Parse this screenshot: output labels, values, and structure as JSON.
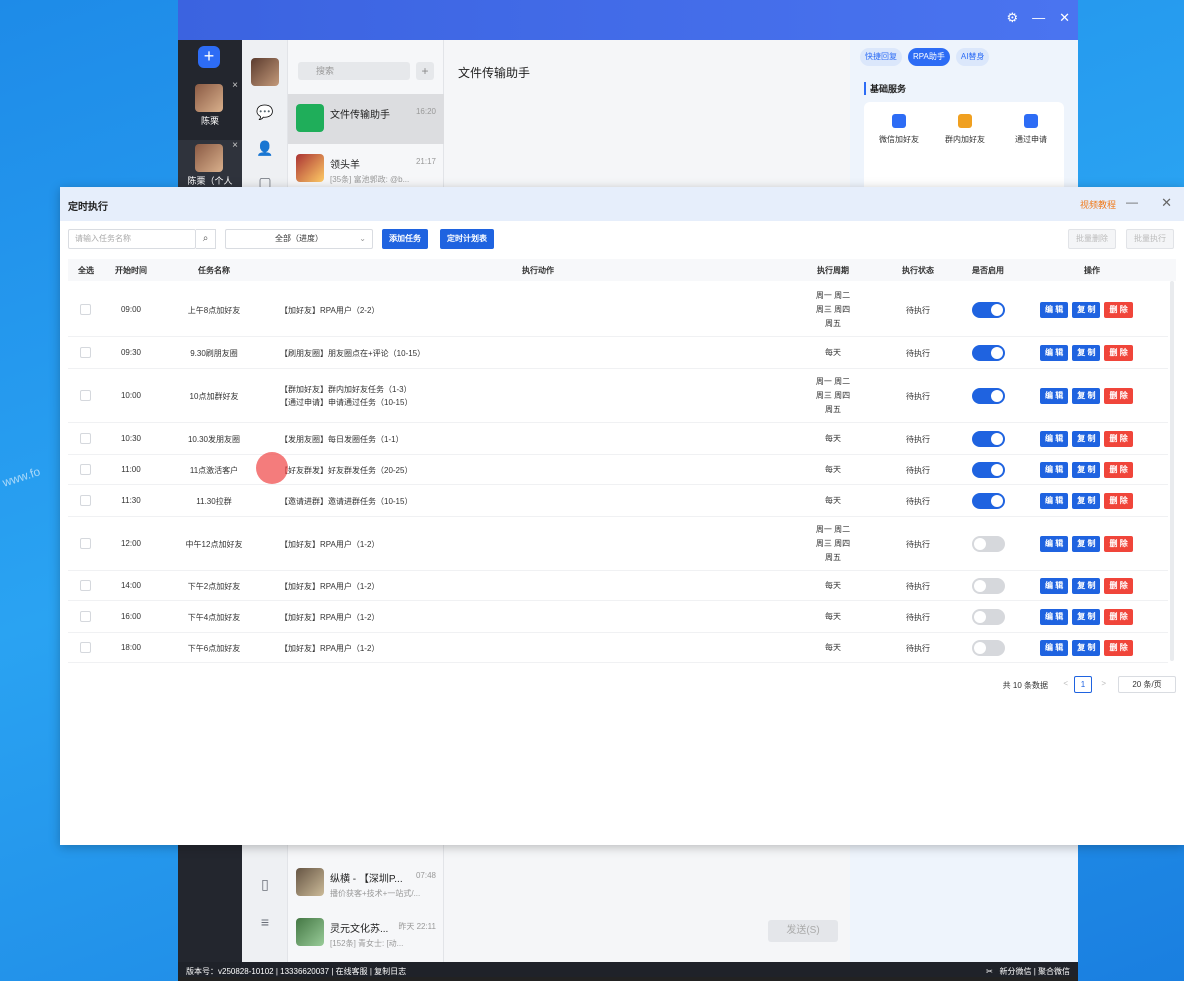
{
  "background_app": {
    "rail": {
      "accounts": [
        {
          "name": "陈栗",
          "close": "×"
        },
        {
          "name": "陈栗（个人",
          "close": "×"
        }
      ]
    },
    "list": {
      "search_placeholder": "搜索",
      "add": "+",
      "conversations": [
        {
          "name": "文件传输助手",
          "time": "16:20",
          "snippet": ""
        },
        {
          "name": "领头羊",
          "time": "21:17",
          "snippet": "[35条] 富池郭政: @b..."
        },
        {
          "name": "纵横 - 【深圳P...",
          "time": "07:48",
          "snippet": "播价获客+技术+一站式/..."
        },
        {
          "name": "灵元文化苏...",
          "time": "昨天 22:11",
          "snippet": "[152条] 青女士: [动..."
        }
      ]
    },
    "chat_title": "文件传输助手",
    "send_label": "发送(S)",
    "right_panel": {
      "tabs": [
        "快捷回复",
        "RPA助手",
        "AI替身"
      ],
      "section_title": "基础服务",
      "services": [
        "微信加好友",
        "群内加好友",
        "通过申请"
      ]
    },
    "status_bar": {
      "version": "版本号：v250828-10102",
      "phone": "13336620037",
      "online": "在线客服",
      "log": "复制日志",
      "split": "新分微信",
      "aggregate": "聚合微信"
    }
  },
  "dialog": {
    "title": "定时执行",
    "video_link": "视频教程",
    "minimize": "—",
    "close": "✕",
    "toolbar": {
      "search_placeholder": "请输入任务名称",
      "filter_value": "全部（进度）",
      "add_task": "添加任务",
      "schedule": "定时计划表",
      "batch_delete": "批量删除",
      "batch_execute": "批量执行"
    },
    "columns": [
      "全选",
      "开始时间",
      "任务名称",
      "执行动作",
      "执行周期",
      "执行状态",
      "是否启用",
      "操作"
    ],
    "action_labels": {
      "edit": "编 辑",
      "copy": "复 制",
      "delete": "删 除"
    },
    "rows": [
      {
        "time": "09:00",
        "name": "上午8点加好友",
        "actions": [
          "【加好友】RPA用户（2-2）"
        ],
        "period": [
          "周一 周二",
          "周三 周四",
          "周五"
        ],
        "status": "待执行",
        "enabled": true
      },
      {
        "time": "09:30",
        "name": "9.30刷朋友圈",
        "actions": [
          "【刷朋友圈】朋友圈点在+评论（10-15）"
        ],
        "period": [
          "每天"
        ],
        "status": "待执行",
        "enabled": true
      },
      {
        "time": "10:00",
        "name": "10点加群好友",
        "actions": [
          "【群加好友】群内加好友任务（1-3）",
          "【通过申请】申请通过任务（10-15）"
        ],
        "period": [
          "周一 周二",
          "周三 周四",
          "周五"
        ],
        "status": "待执行",
        "enabled": true
      },
      {
        "time": "10:30",
        "name": "10.30发朋友圈",
        "actions": [
          "【发朋友圈】每日发圈任务（1-1）"
        ],
        "period": [
          "每天"
        ],
        "status": "待执行",
        "enabled": true
      },
      {
        "time": "11:00",
        "name": "11点激活客户",
        "actions": [
          "【好友群发】好友群发任务（20-25）"
        ],
        "period": [
          "每天"
        ],
        "status": "待执行",
        "enabled": true
      },
      {
        "time": "11:30",
        "name": "11.30拉群",
        "actions": [
          "【邀请进群】邀请进群任务（10-15）"
        ],
        "period": [
          "每天"
        ],
        "status": "待执行",
        "enabled": true
      },
      {
        "time": "12:00",
        "name": "中午12点加好友",
        "actions": [
          "【加好友】RPA用户（1-2）"
        ],
        "period": [
          "周一 周二",
          "周三 周四",
          "周五"
        ],
        "status": "待执行",
        "enabled": false
      },
      {
        "time": "14:00",
        "name": "下午2点加好友",
        "actions": [
          "【加好友】RPA用户（1-2）"
        ],
        "period": [
          "每天"
        ],
        "status": "待执行",
        "enabled": false
      },
      {
        "time": "16:00",
        "name": "下午4点加好友",
        "actions": [
          "【加好友】RPA用户（1-2）"
        ],
        "period": [
          "每天"
        ],
        "status": "待执行",
        "enabled": false
      },
      {
        "time": "18:00",
        "name": "下午6点加好友",
        "actions": [
          "【加好友】RPA用户（1-2）"
        ],
        "period": [
          "每天"
        ],
        "status": "待执行",
        "enabled": false
      }
    ],
    "pagination": {
      "total": "共 10 条数据",
      "prev": "<",
      "page": "1",
      "next": ">",
      "page_size": "20 条/页"
    }
  },
  "watermark": "www.fo"
}
